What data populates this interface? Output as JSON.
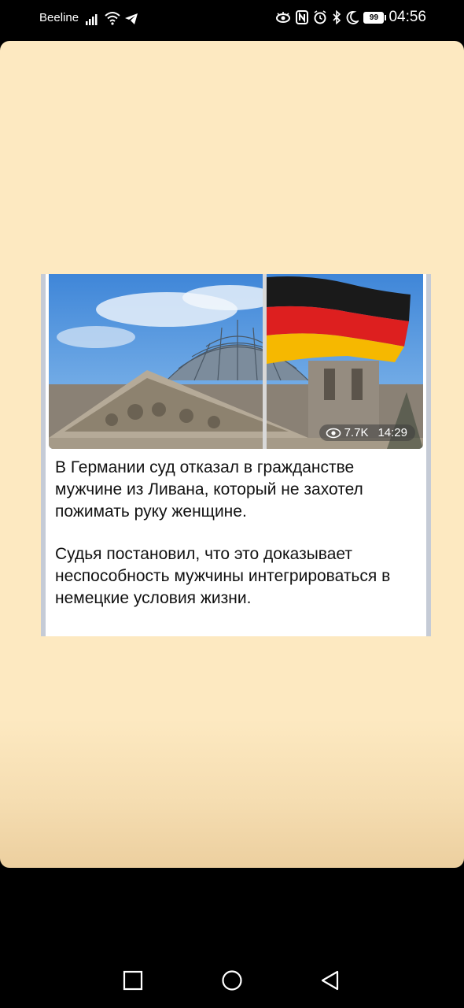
{
  "status_bar": {
    "carrier": "Beeline",
    "battery": "99",
    "time": "04:56"
  },
  "post": {
    "views": "7.7K",
    "time": "14:29",
    "paragraphs": [
      "В Германии суд отказал в гражданстве мужчине из Ливана, который не захотел пожимать руку женщине.",
      "Судья постановил, что это доказывает неспособность мужчины интегрироваться в немецкие условия жизни."
    ]
  },
  "colors": {
    "panel_bg": "#fde9c1",
    "flag_black": "#1a1a1a",
    "flag_red": "#dd1f1f",
    "flag_gold": "#f6b800"
  }
}
